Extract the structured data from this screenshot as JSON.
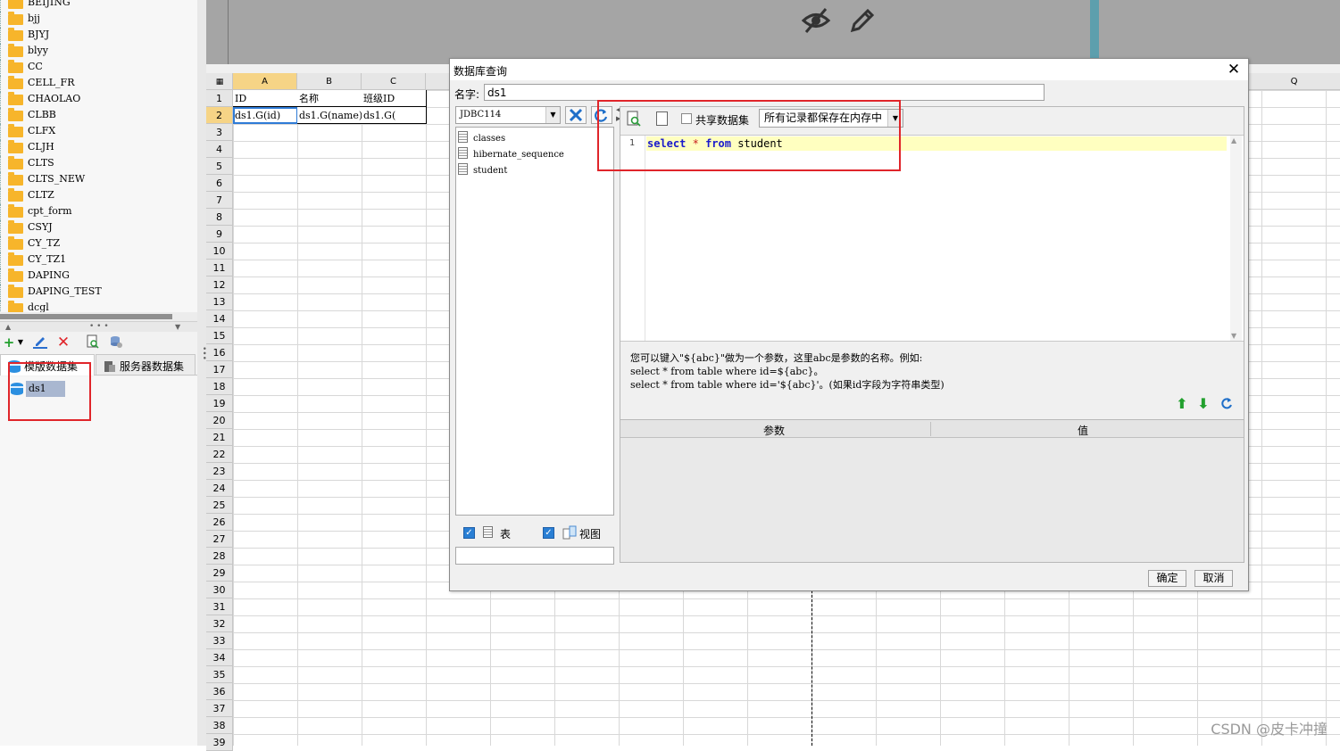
{
  "tree": {
    "items": [
      "BEIJING",
      "bjj",
      "BJYJ",
      "blyy",
      "CC",
      "CELL_FR",
      "CHAOLAO",
      "CLBB",
      "CLFX",
      "CLJH",
      "CLTS",
      "CLTS_NEW",
      "CLTZ",
      "cpt_form",
      "CSYJ",
      "CY_TZ",
      "CY_TZ1",
      "DAPING",
      "DAPING_TEST",
      "dcgl"
    ]
  },
  "dataset_panel": {
    "toolbar": {
      "add": "+",
      "edit": "edit-icon",
      "delete": "delete-icon",
      "preview": "preview-icon",
      "server": "server-icon"
    },
    "tabs": [
      "模版数据集",
      "服务器数据集"
    ],
    "datasets": [
      "ds1"
    ]
  },
  "sheet": {
    "columns": [
      "A",
      "B",
      "C"
    ],
    "extra_column": "Q",
    "rows": [
      "1",
      "2",
      "3",
      "4",
      "5",
      "6",
      "7",
      "8",
      "9",
      "10",
      "11",
      "12",
      "13",
      "14",
      "15",
      "16",
      "17",
      "18",
      "19",
      "20",
      "21",
      "22",
      "23",
      "24",
      "25",
      "26",
      "27",
      "28",
      "29",
      "30",
      "31",
      "32",
      "33",
      "34",
      "35",
      "36",
      "37",
      "38",
      "39"
    ],
    "cells": {
      "a1": "ID",
      "b1": "名称",
      "c1": "班级ID",
      "a2": "ds1.G(id)",
      "b2": "ds1.G(name)",
      "c2": "ds1.G("
    }
  },
  "dialog": {
    "title": "数据库查询",
    "close": "✕",
    "name_label": "名字:",
    "name_value": "ds1",
    "connection": "JDBC114",
    "tables": [
      "classes",
      "hibernate_sequence",
      "student"
    ],
    "show_tables_label": "表",
    "show_views_label": "视图",
    "share_dataset_label": "共享数据集",
    "cache_option": "所有记录都保存在内存中",
    "sql": {
      "line_number": "1",
      "keyword_select": "select",
      "star": "*",
      "keyword_from": "from",
      "table": "student"
    },
    "hint": [
      "您可以键入\"${abc}\"做为一个参数，这里abc是参数的名称。例如:",
      "select * from table where id=${abc}。",
      "select * from table where id='${abc}'。(如果id字段为字符串类型)"
    ],
    "param_headers": [
      "参数",
      "值"
    ],
    "ok": "确定",
    "cancel": "取消"
  },
  "watermark": "CSDN @皮卡冲撞"
}
